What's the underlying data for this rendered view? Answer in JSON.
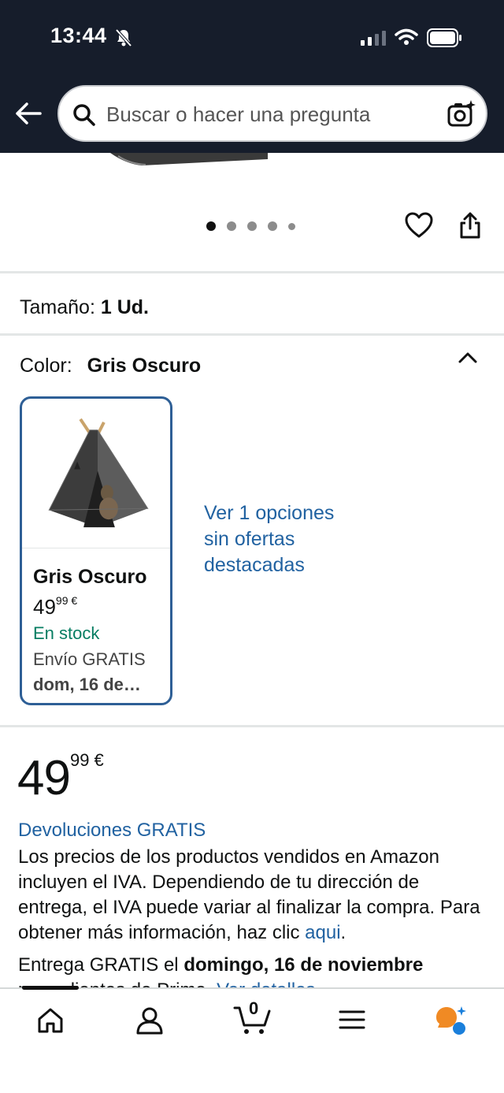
{
  "status_bar": {
    "time": "13:44"
  },
  "search": {
    "placeholder": "Buscar o hacer una pregunta"
  },
  "product": {
    "size_label": "Tamaño:",
    "size_value": "1 Ud.",
    "color_label": "Color:",
    "color_value": "Gris Oscuro",
    "variant": {
      "name": "Gris Oscuro",
      "price_whole": "49",
      "price_fraction": "99 €",
      "stock": "En stock",
      "shipping": "Envío GRATIS",
      "date": "dom, 16 de…"
    },
    "more_options": "Ver 1 opciones sin ofertas destacadas",
    "price_whole": "49",
    "price_fraction": "99 €",
    "returns": "Devoluciones GRATIS",
    "tax_text": "Los precios de los productos vendidos en Amazon incluyen el IVA. Dependiendo de tu dirección de entrega, el IVA puede variar al finalizar la compra. Para obtener más información, haz clic ",
    "tax_link": "aqui",
    "tax_end": ".",
    "delivery_prefix": "Entrega GRATIS el ",
    "delivery_date": "domingo, 16 de noviembre",
    "delivery_suffix": "para clientes de Prime. ",
    "delivery_link": "Ver detalles"
  },
  "bottom_nav": {
    "items": [
      "home-icon",
      "account-icon",
      "cart-icon",
      "menu-icon",
      "rufus-icon"
    ],
    "cart_count": "0"
  },
  "colors": {
    "header_bg": "#161d2b",
    "link": "#2162a1",
    "in_stock": "#067d62",
    "swatch_border": "#2e5f96"
  }
}
